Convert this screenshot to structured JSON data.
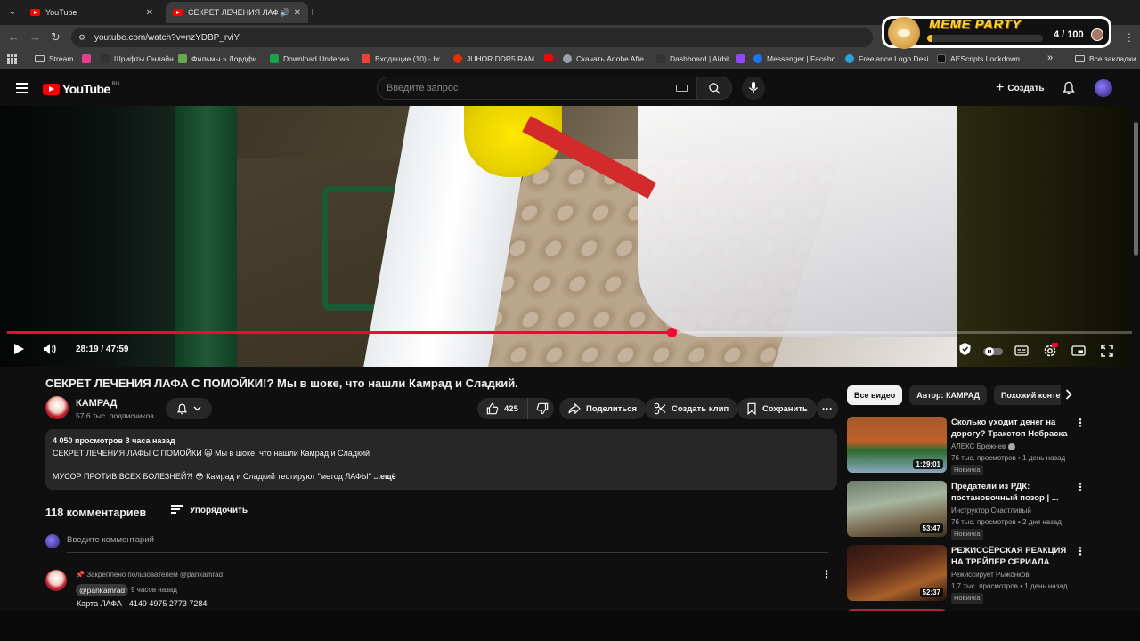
{
  "browser": {
    "tabs": [
      {
        "title": "YouTube",
        "active": false
      },
      {
        "title": "СЕКРЕТ ЛЕЧЕНИЯ ЛАФА С",
        "active": true
      }
    ],
    "url": "youtube.com/watch?v=nzYDBP_rviY",
    "bookmarks": [
      {
        "label": "Stream",
        "icon": "folder-icon"
      },
      {
        "label": "",
        "icon": "lh-icon",
        "color": "#e83e8c"
      },
      {
        "label": "Шрифты Онлайн",
        "icon": "font-site-icon",
        "color": "#333333"
      },
      {
        "label": "Фильмы » Лордфи...",
        "icon": "film-site-icon",
        "color": "#6aa84f"
      },
      {
        "label": "Download Underwa...",
        "icon": "ae-icon",
        "color": "#16a34a"
      },
      {
        "label": "Входящие (10) - br...",
        "icon": "gmail-icon",
        "color": "#ea4335"
      },
      {
        "label": "JUHOR DDR5 RAM...",
        "icon": "aliexpress-icon",
        "color": "#e62e04"
      },
      {
        "label": "",
        "icon": "youtube-icon",
        "color": "#ff0000"
      },
      {
        "label": "Скачать Adobe Afte...",
        "icon": "globe-icon",
        "color": "#9aa0a6"
      },
      {
        "label": "Dashboard | Airbit",
        "icon": "airbit-icon",
        "color": "#333333"
      },
      {
        "label": "",
        "icon": "twitch-icon",
        "color": "#9146ff"
      },
      {
        "label": "Messenger | Facebo...",
        "icon": "facebook-icon",
        "color": "#1877f2"
      },
      {
        "label": "Freelance Logo Desi...",
        "icon": "freelance-icon",
        "color": "#2aa0d8"
      },
      {
        "label": "AEScripts Lockdown...",
        "icon": "aescripts-icon",
        "color": "#111111"
      }
    ],
    "all_bookmarks": "Все закладки",
    "more_bookmarks": "»"
  },
  "meme_party": {
    "title": "MEME PARTY",
    "score": "4 / 100",
    "progress": 0.04
  },
  "header": {
    "logo_text": "YouTube",
    "region": "RU",
    "search_placeholder": "Введите запрос",
    "create_label": "Создать"
  },
  "player": {
    "current_time": "28:19",
    "total_time": "47:59",
    "time_display": "28:19 / 47:59",
    "progress": 0.5901
  },
  "video": {
    "title": "СЕКРЕТ ЛЕЧЕНИЯ ЛАФА С ПОМОЙКИ!? Мы в шоке, что нашли Камрад и Сладкий.",
    "channel": "КАМРАД",
    "subscribers": "57,6 тыс. подписчиков",
    "likes": "425",
    "share_label": "Поделиться",
    "clip_label": "Создать клип",
    "save_label": "Сохранить"
  },
  "description": {
    "stats": "4 050 просмотров  3 часа назад",
    "line1": "СЕКРЕТ ЛЕЧЕНИЯ ЛАФЫ С ПОМОЙКИ 🙀 Мы в шоке, что нашли Камрад и Сладкий",
    "line2": "МУСОР ПРОТИВ ВСЕХ БОЛЕЗНЕЙ?! 😳 Камрад и Сладкий тестируют \"метод ЛАФЫ\"",
    "more": "...ещё"
  },
  "comments": {
    "count_label": "118 комментариев",
    "sort_label": "Упорядочить",
    "input_placeholder": "Введите комментарий",
    "pinned_comment": {
      "pinned_label": "Закреплено пользователем @pankamrad",
      "author": "@pankamrad",
      "time": "9 часов назад",
      "text": "Карта   ЛАФА  -  4149 4975 2773 7284"
    }
  },
  "sidebar": {
    "chips": [
      "Все видео",
      "Автор: КАМРАД",
      "Похожий конте"
    ],
    "recommendations": [
      {
        "title": "Сколько уходит денег на дорогу? Тракстоп Небраска ...",
        "channel": "АЛЕКС Брежнев",
        "verified": true,
        "meta": "76 тыс. просмотров • 1 день назад",
        "badge": "Новинка",
        "duration": "1:29:01"
      },
      {
        "title": "Предатели из РДК: постановочный позор | ...",
        "channel": "Инструктор Счастливый",
        "verified": false,
        "meta": "76 тыс. просмотров • 2 дня назад",
        "badge": "Новинка",
        "duration": "53:47"
      },
      {
        "title": "РЕЖИССЁРСКАЯ РЕАКЦИЯ НА ТРЕЙЛЕР СЕРИАЛА HARRY ...",
        "channel": "Режиссирует Рыжонков",
        "verified": false,
        "meta": "1,7 тыс. просмотров • 1 день назад",
        "badge": "Новинка",
        "duration": "52:37"
      }
    ]
  }
}
